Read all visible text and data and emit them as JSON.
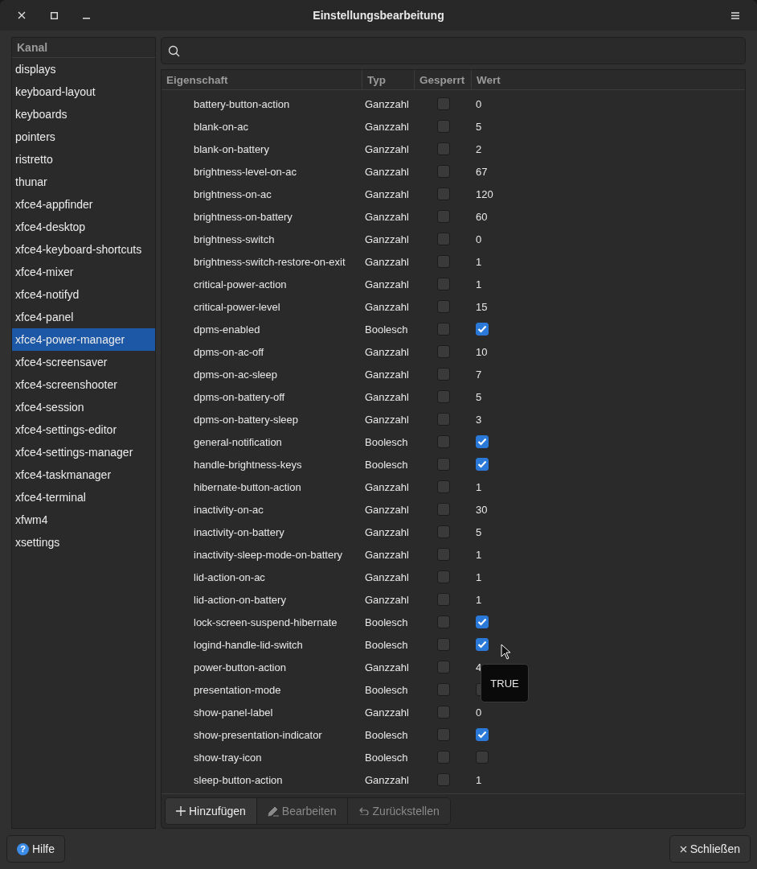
{
  "window": {
    "title": "Einstellungsbearbeitung"
  },
  "sidebar": {
    "header": "Kanal",
    "items": [
      {
        "label": "displays",
        "selected": false
      },
      {
        "label": "keyboard-layout",
        "selected": false
      },
      {
        "label": "keyboards",
        "selected": false
      },
      {
        "label": "pointers",
        "selected": false
      },
      {
        "label": "ristretto",
        "selected": false
      },
      {
        "label": "thunar",
        "selected": false
      },
      {
        "label": "xfce4-appfinder",
        "selected": false
      },
      {
        "label": "xfce4-desktop",
        "selected": false
      },
      {
        "label": "xfce4-keyboard-shortcuts",
        "selected": false
      },
      {
        "label": "xfce4-mixer",
        "selected": false
      },
      {
        "label": "xfce4-notifyd",
        "selected": false
      },
      {
        "label": "xfce4-panel",
        "selected": false
      },
      {
        "label": "xfce4-power-manager",
        "selected": true
      },
      {
        "label": "xfce4-screensaver",
        "selected": false
      },
      {
        "label": "xfce4-screenshooter",
        "selected": false
      },
      {
        "label": "xfce4-session",
        "selected": false
      },
      {
        "label": "xfce4-settings-editor",
        "selected": false
      },
      {
        "label": "xfce4-settings-manager",
        "selected": false
      },
      {
        "label": "xfce4-taskmanager",
        "selected": false
      },
      {
        "label": "xfce4-terminal",
        "selected": false
      },
      {
        "label": "xfwm4",
        "selected": false
      },
      {
        "label": "xsettings",
        "selected": false
      }
    ]
  },
  "table": {
    "columns": [
      "Eigenschaft",
      "Typ",
      "Gesperrt",
      "Wert"
    ],
    "rows": [
      {
        "name": "battery-button-action",
        "type": "Ganzzahl",
        "locked": false,
        "kind": "number",
        "value": "0"
      },
      {
        "name": "blank-on-ac",
        "type": "Ganzzahl",
        "locked": false,
        "kind": "number",
        "value": "5"
      },
      {
        "name": "blank-on-battery",
        "type": "Ganzzahl",
        "locked": false,
        "kind": "number",
        "value": "2"
      },
      {
        "name": "brightness-level-on-ac",
        "type": "Ganzzahl",
        "locked": false,
        "kind": "number",
        "value": "67"
      },
      {
        "name": "brightness-on-ac",
        "type": "Ganzzahl",
        "locked": false,
        "kind": "number",
        "value": "120"
      },
      {
        "name": "brightness-on-battery",
        "type": "Ganzzahl",
        "locked": false,
        "kind": "number",
        "value": "60"
      },
      {
        "name": "brightness-switch",
        "type": "Ganzzahl",
        "locked": false,
        "kind": "number",
        "value": "0"
      },
      {
        "name": "brightness-switch-restore-on-exit",
        "type": "Ganzzahl",
        "locked": false,
        "kind": "number",
        "value": "1"
      },
      {
        "name": "critical-power-action",
        "type": "Ganzzahl",
        "locked": false,
        "kind": "number",
        "value": "1"
      },
      {
        "name": "critical-power-level",
        "type": "Ganzzahl",
        "locked": false,
        "kind": "number",
        "value": "15"
      },
      {
        "name": "dpms-enabled",
        "type": "Boolesch",
        "locked": false,
        "kind": "boolean",
        "checked": true
      },
      {
        "name": "dpms-on-ac-off",
        "type": "Ganzzahl",
        "locked": false,
        "kind": "number",
        "value": "10"
      },
      {
        "name": "dpms-on-ac-sleep",
        "type": "Ganzzahl",
        "locked": false,
        "kind": "number",
        "value": "7"
      },
      {
        "name": "dpms-on-battery-off",
        "type": "Ganzzahl",
        "locked": false,
        "kind": "number",
        "value": "5"
      },
      {
        "name": "dpms-on-battery-sleep",
        "type": "Ganzzahl",
        "locked": false,
        "kind": "number",
        "value": "3"
      },
      {
        "name": "general-notification",
        "type": "Boolesch",
        "locked": false,
        "kind": "boolean",
        "checked": true
      },
      {
        "name": "handle-brightness-keys",
        "type": "Boolesch",
        "locked": false,
        "kind": "boolean",
        "checked": true
      },
      {
        "name": "hibernate-button-action",
        "type": "Ganzzahl",
        "locked": false,
        "kind": "number",
        "value": "1"
      },
      {
        "name": "inactivity-on-ac",
        "type": "Ganzzahl",
        "locked": false,
        "kind": "number",
        "value": "30"
      },
      {
        "name": "inactivity-on-battery",
        "type": "Ganzzahl",
        "locked": false,
        "kind": "number",
        "value": "5"
      },
      {
        "name": "inactivity-sleep-mode-on-battery",
        "type": "Ganzzahl",
        "locked": false,
        "kind": "number",
        "value": "1"
      },
      {
        "name": "lid-action-on-ac",
        "type": "Ganzzahl",
        "locked": false,
        "kind": "number",
        "value": "1"
      },
      {
        "name": "lid-action-on-battery",
        "type": "Ganzzahl",
        "locked": false,
        "kind": "number",
        "value": "1"
      },
      {
        "name": "lock-screen-suspend-hibernate",
        "type": "Boolesch",
        "locked": false,
        "kind": "boolean",
        "checked": true
      },
      {
        "name": "logind-handle-lid-switch",
        "type": "Boolesch",
        "locked": false,
        "kind": "boolean",
        "checked": true
      },
      {
        "name": "power-button-action",
        "type": "Ganzzahl",
        "locked": false,
        "kind": "number",
        "value": "4"
      },
      {
        "name": "presentation-mode",
        "type": "Boolesch",
        "locked": false,
        "kind": "boolean",
        "checked": false
      },
      {
        "name": "show-panel-label",
        "type": "Ganzzahl",
        "locked": false,
        "kind": "number",
        "value": "0"
      },
      {
        "name": "show-presentation-indicator",
        "type": "Boolesch",
        "locked": false,
        "kind": "boolean",
        "checked": true
      },
      {
        "name": "show-tray-icon",
        "type": "Boolesch",
        "locked": false,
        "kind": "boolean",
        "checked": false
      },
      {
        "name": "sleep-button-action",
        "type": "Ganzzahl",
        "locked": false,
        "kind": "number",
        "value": "1"
      }
    ]
  },
  "tooltip": {
    "text": "TRUE"
  },
  "toolbar": [
    {
      "label": "Hinzufügen",
      "kind": "add",
      "disabled": false
    },
    {
      "label": "Bearbeiten",
      "kind": "edit",
      "disabled": true
    },
    {
      "label": "Zurückstellen",
      "kind": "reset",
      "disabled": true
    }
  ],
  "footer": {
    "help": "Hilfe",
    "help_badge": "?",
    "close": "Schließen"
  }
}
